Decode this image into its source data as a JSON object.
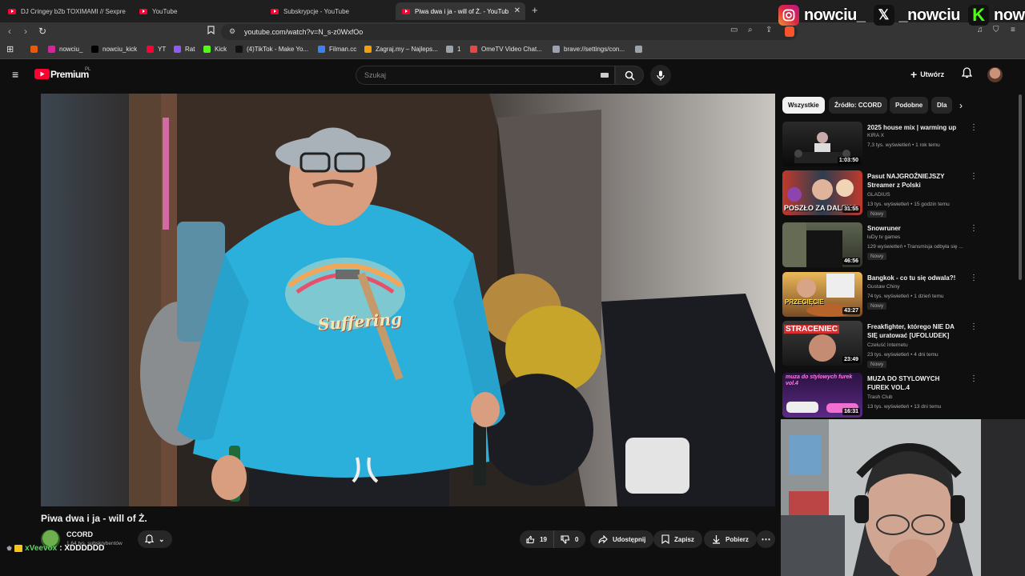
{
  "browser": {
    "tabs": [
      {
        "label": "DJ Cringey b2b TOXIMAMI // Sexpre",
        "active": false
      },
      {
        "label": "YouTube",
        "active": false
      },
      {
        "label": "Subskrypcje - YouTube",
        "active": false
      },
      {
        "label": "Piwa dwa i ja - will of Ż. - YouTub",
        "active": true
      }
    ],
    "url": "youtube.com/watch?v=N_s-z0WxfOo",
    "bookmarks": [
      {
        "label": "",
        "color": "#e8590c"
      },
      {
        "label": "nowciu_",
        "color": "#d6249f"
      },
      {
        "label": "nowciu_kick",
        "color": "#000000"
      },
      {
        "label": "YT",
        "color": "#ff0033"
      },
      {
        "label": "Rat",
        "color": "#8b5cf6"
      },
      {
        "label": "Kick",
        "color": "#53fc18"
      },
      {
        "label": "(4)TikTok - Make Yo...",
        "color": "#111111"
      },
      {
        "label": "Filman.cc",
        "color": "#3b82f6"
      },
      {
        "label": "Zagraj.my – Najleps...",
        "color": "#f59e0b"
      },
      {
        "label": "1",
        "color": "#9ca3af"
      },
      {
        "label": "OmeTV Video Chat...",
        "color": "#ef4444"
      },
      {
        "label": "brave://settings/con...",
        "color": "#9ca3af"
      },
      {
        "label": "",
        "color": "#9ca3af"
      }
    ]
  },
  "overlay": {
    "instagram": "nowciu_",
    "x": "_nowciu",
    "kick": "nowciu"
  },
  "youtube": {
    "logo": "Premium",
    "region": "PL",
    "search_placeholder": "Szukaj",
    "create_label": "Utwórz",
    "chips": [
      "Wszystkie",
      "Źródło: CCORD",
      "Podobne",
      "Dla"
    ],
    "video": {
      "title": "Piwa dwa i ja - will of Ż.",
      "channel": "CCORD",
      "subscribers": "1,64 tys. subskrybentów",
      "likes": "19",
      "dislikes": "0",
      "share_label": "Udostępnij",
      "save_label": "Zapisz",
      "download_label": "Pobierz",
      "shirt_text": "Suffering"
    },
    "recommendations": [
      {
        "title": "2025 house mix | warming up",
        "channel": "KIRA X",
        "meta": "7,3 tys. wyświetleń • 1 rok temu",
        "duration": "1:03:50",
        "badge": ""
      },
      {
        "title": "Pasut NAJGROŹNIEJSZY Streamer z Polski",
        "channel": "GLADIUS",
        "meta": "13 tys. wyświetleń • 15 godzin temu",
        "duration": "31:55",
        "badge": "Nowy",
        "thumb_text": "POSZŁO ZA DALEKO"
      },
      {
        "title": "Snowruner",
        "channel": "luDy tv games",
        "meta": "129 wyświetleń • Transmisja odbyła się ...",
        "duration": "46:56",
        "badge": "Nowy"
      },
      {
        "title": "Bangkok - co tu się odwala?!",
        "channel": "Gustaw Chiny",
        "meta": "74 tys. wyświetleń • 1 dzień temu",
        "duration": "43:27",
        "badge": "Nowy",
        "thumb_text": "PRZEGIĘCIE"
      },
      {
        "title": "Freakfighter, którego NIE DA SIĘ uratować [UFOLUDEK]",
        "channel": "Czeluść Internetu",
        "meta": "23 tys. wyświetleń • 4 dni temu",
        "duration": "23:49",
        "badge": "Nowy",
        "thumb_text": "STRACENIEC"
      },
      {
        "title": "MUZA DO STYLOWYCH FUREK VOL.4",
        "channel": "Trash Club",
        "meta": "13 tys. wyświetleń • 13 dni temu",
        "duration": "16:31",
        "badge": "",
        "thumb_text": "muza do stylowych furek vol.4"
      }
    ]
  },
  "chat": {
    "user": "xVeevox",
    "message": ": XDDDDDD"
  }
}
